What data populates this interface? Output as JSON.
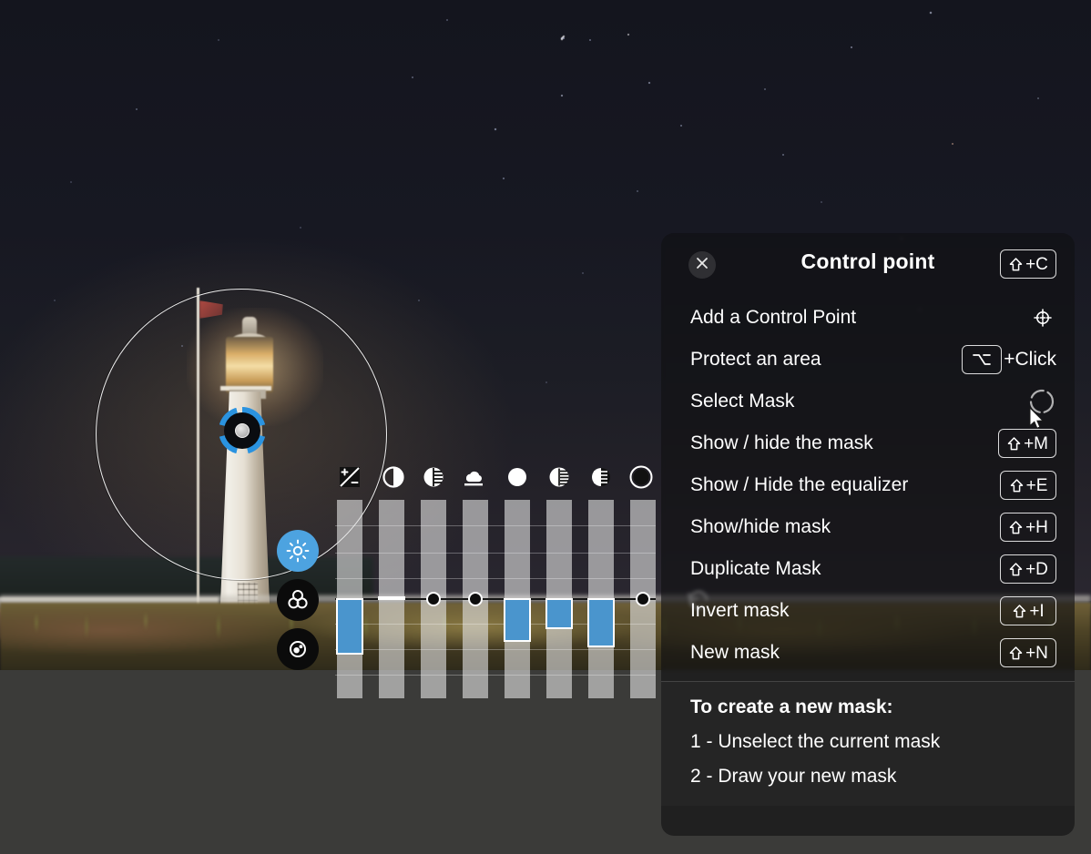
{
  "app": {
    "background_color": "#3b3b39",
    "photo_description": "night-sky-lighthouse-photo"
  },
  "panel": {
    "title": "Control point",
    "title_shortcut": "⇧+C",
    "close_icon": "close-icon",
    "items": [
      {
        "label": "Add a Control Point",
        "shortcut": "",
        "icon": "crosshair-target-icon"
      },
      {
        "label": "Protect an area",
        "shortcut": "⌥",
        "suffix": "+Click",
        "icon": "option-key-icon"
      },
      {
        "label": "Select Mask",
        "shortcut": "",
        "icon": "dashed-circle-mask-icon"
      },
      {
        "label": "Show / hide the mask",
        "shortcut": "⇧+M",
        "icon": ""
      },
      {
        "label": "Show / Hide the equalizer",
        "shortcut": "⇧+E",
        "icon": ""
      },
      {
        "label": "Show/hide mask",
        "shortcut": "⇧+H",
        "icon": ""
      },
      {
        "label": "Duplicate Mask",
        "shortcut": "⇧+D",
        "icon": ""
      },
      {
        "label": "Invert mask",
        "shortcut": "⇧+I",
        "icon": ""
      },
      {
        "label": "New mask",
        "shortcut": "⇧+N",
        "icon": ""
      }
    ],
    "footer": {
      "title": "To create a new mask:",
      "lines": [
        "1 - Unselect the current mask",
        "2 - Draw your new mask"
      ]
    }
  },
  "tool_buttons": [
    {
      "name": "light-tool",
      "icon": "sun-icon",
      "active": true,
      "color": "#4da3e0"
    },
    {
      "name": "color-tool",
      "icon": "color-circles-icon",
      "active": false,
      "color": "#0b0b0b"
    },
    {
      "name": "detail-tool",
      "icon": "detail-target-icon",
      "active": false,
      "color": "#0b0b0b"
    }
  ],
  "icon_strip": [
    {
      "name": "exposure-icon",
      "glyph": "exposure"
    },
    {
      "name": "contrast-icon",
      "glyph": "half-circle"
    },
    {
      "name": "clarity-icon",
      "glyph": "striped-circle"
    },
    {
      "name": "dehaze-icon",
      "glyph": "cloud"
    },
    {
      "name": "brightness-icon",
      "glyph": "full-circle"
    },
    {
      "name": "highlights-icon",
      "glyph": "gradient-circle"
    },
    {
      "name": "shadows-icon",
      "glyph": "lined-circle"
    },
    {
      "name": "blacks-icon",
      "glyph": "ring-circle"
    }
  ],
  "equalizer": {
    "channels": 8,
    "zero_line": 0,
    "values": [
      -62,
      0,
      0,
      0,
      -48,
      -34,
      -54,
      0
    ],
    "handles": [
      2,
      3,
      7
    ],
    "reset_icon": "reset-arrow-icon",
    "bar_color": "#4a95cd",
    "track_color": "#e1e1e1"
  },
  "control_point_marker": {
    "name": "control-point-marker",
    "ring_color": "#2a93e0"
  },
  "brush_circle": {
    "name": "brush-size-circle"
  },
  "cursor": {
    "name": "mouse-cursor"
  }
}
